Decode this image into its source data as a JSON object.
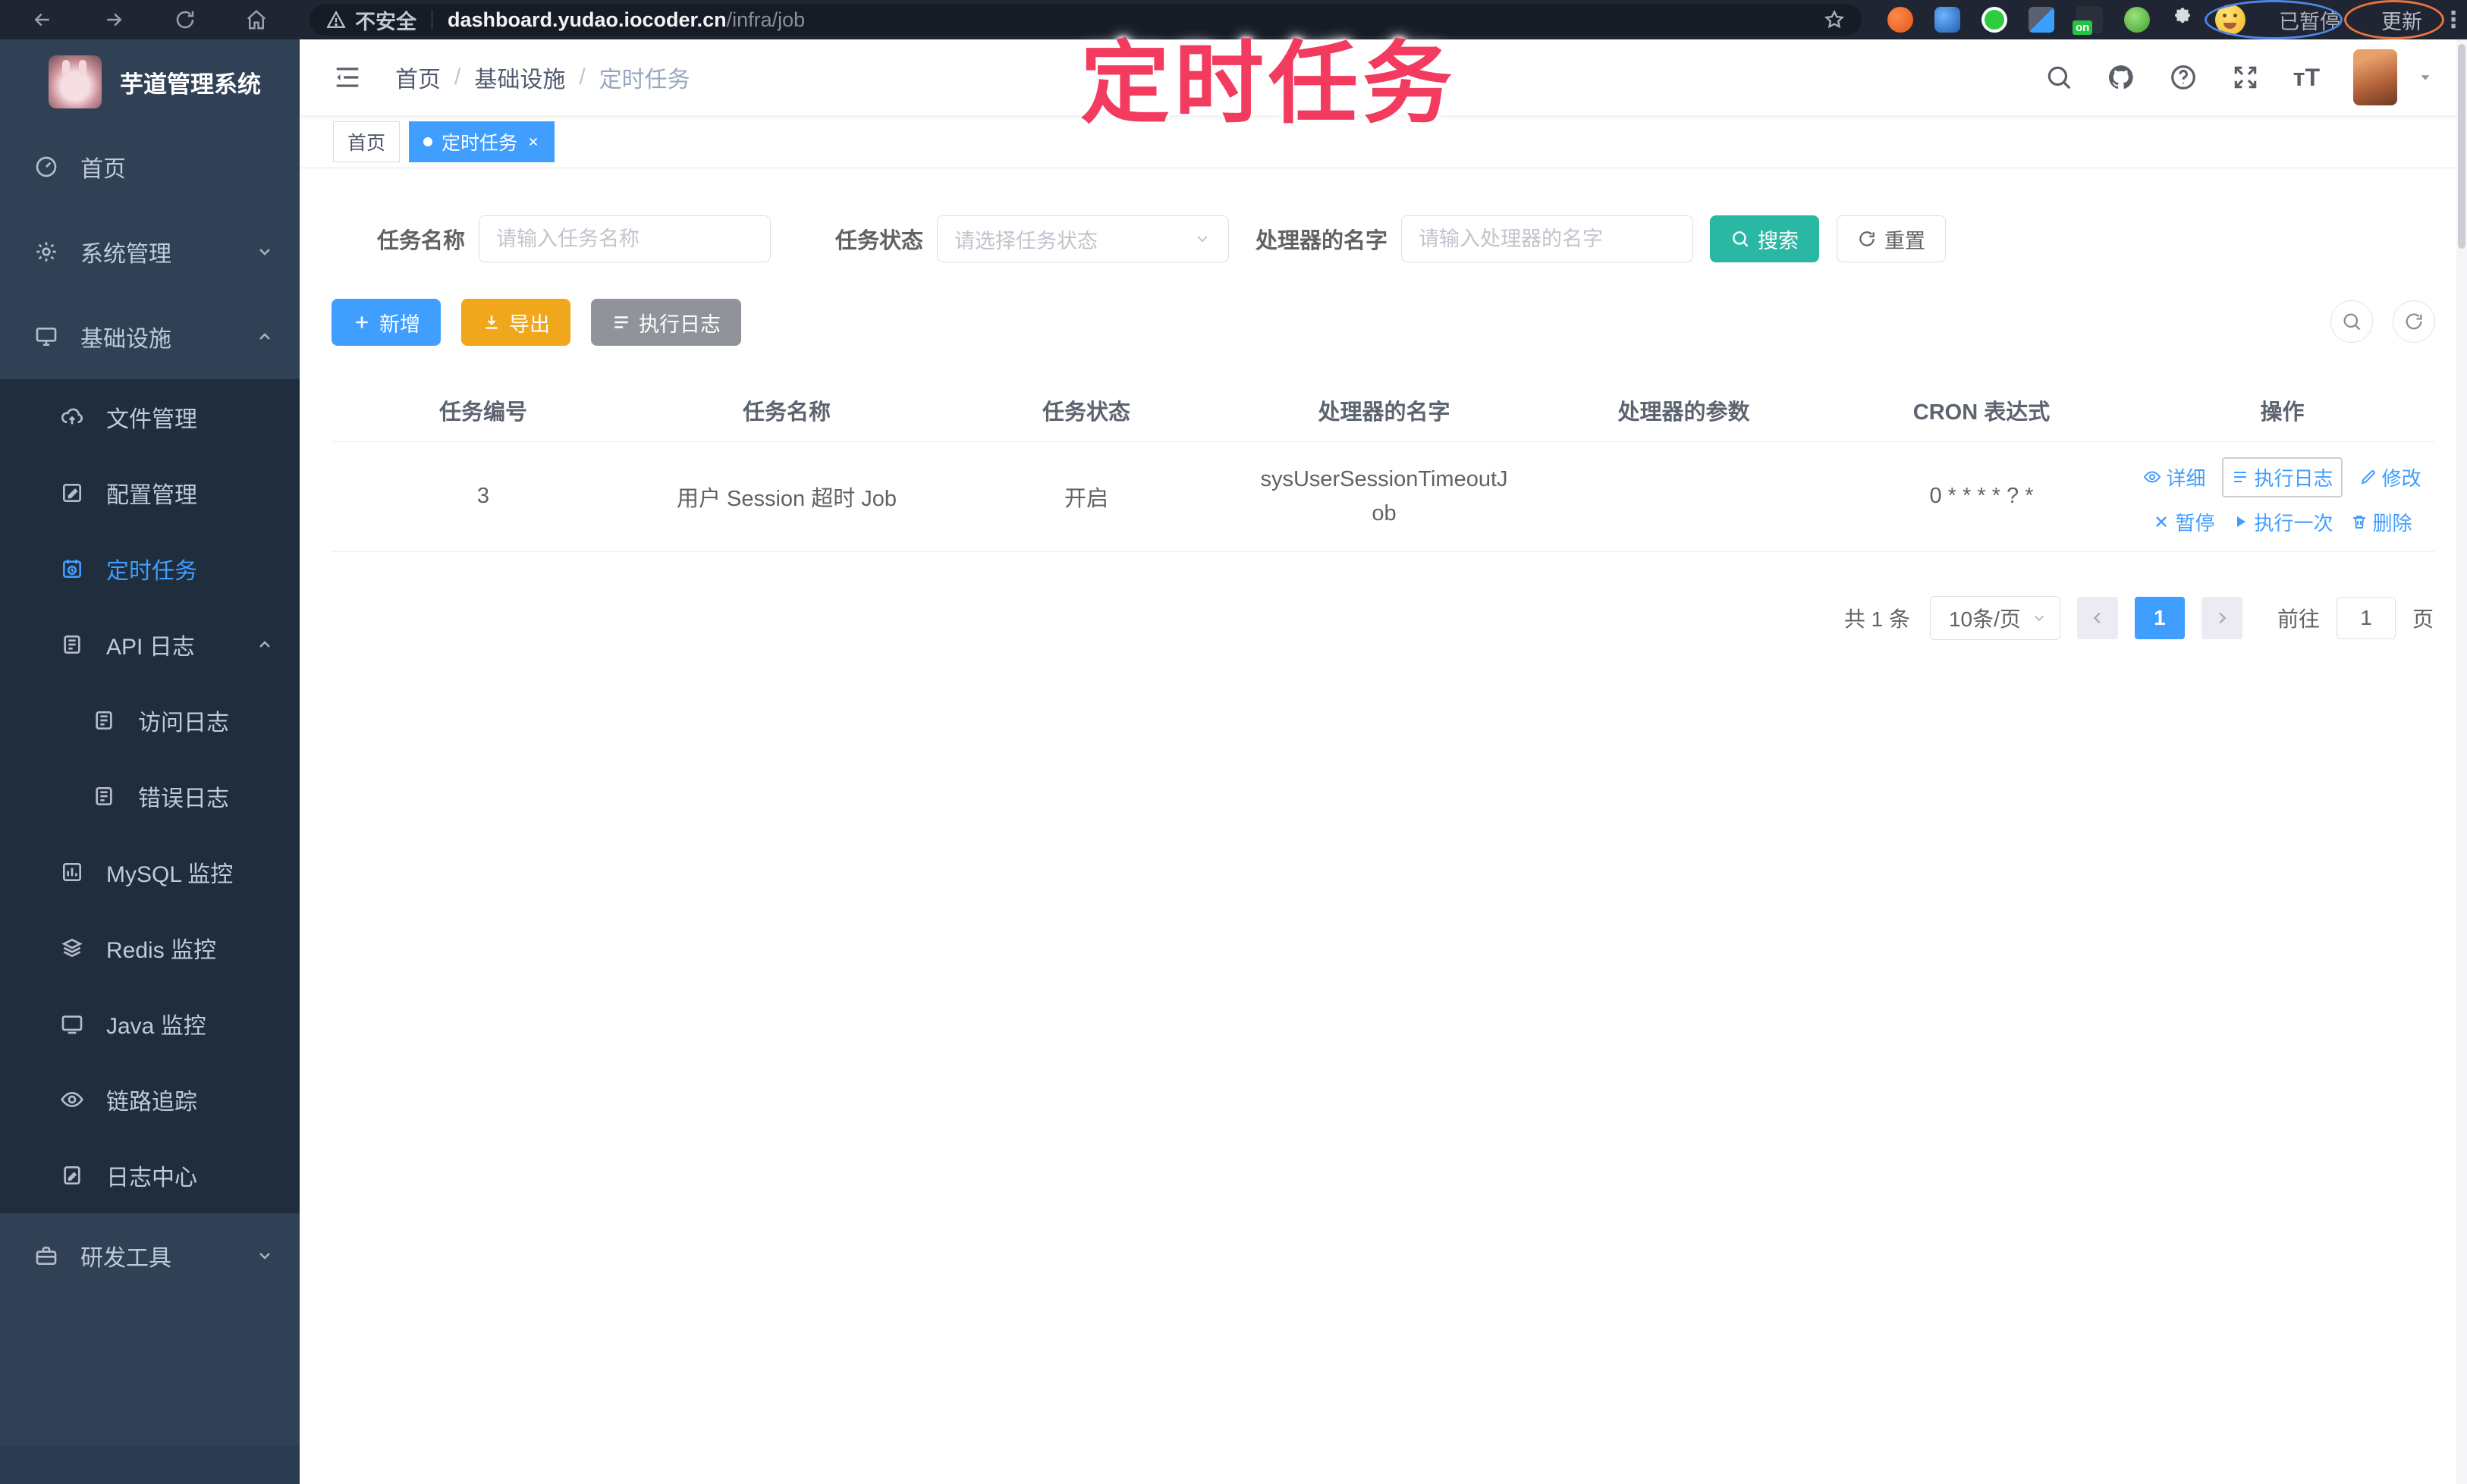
{
  "browser": {
    "security_label": "不安全",
    "url_host": "dashboard.yudao.iocoder.cn",
    "url_path": "/infra/job",
    "extension_badge": "on",
    "paused_label": "已暂停",
    "update_label": "更新"
  },
  "annotation": {
    "title": "定时任务",
    "color": "#f23b5e"
  },
  "sidebar": {
    "app_title": "芋道管理系统",
    "items": [
      {
        "label": "首页",
        "icon": "dashboard-icon"
      },
      {
        "label": "系统管理",
        "icon": "gear-icon",
        "expanded": false
      },
      {
        "label": "基础设施",
        "icon": "monitor-icon",
        "expanded": true,
        "children": [
          {
            "label": "文件管理",
            "icon": "cloud-upload-icon"
          },
          {
            "label": "配置管理",
            "icon": "edit-icon"
          },
          {
            "label": "定时任务",
            "icon": "timer-icon",
            "active": true
          },
          {
            "label": "API 日志",
            "icon": "document-icon",
            "expanded": true,
            "children": [
              {
                "label": "访问日志",
                "icon": "document-icon"
              },
              {
                "label": "错误日志",
                "icon": "document-icon"
              }
            ]
          },
          {
            "label": "MySQL 监控",
            "icon": "chart-icon"
          },
          {
            "label": "Redis 监控",
            "icon": "layers-icon"
          },
          {
            "label": "Java 监控",
            "icon": "display-icon"
          },
          {
            "label": "链路追踪",
            "icon": "eye-icon"
          },
          {
            "label": "日志中心",
            "icon": "document-icon"
          }
        ]
      },
      {
        "label": "研发工具",
        "icon": "briefcase-icon",
        "expanded": false
      }
    ]
  },
  "header": {
    "breadcrumb": [
      "首页",
      "基础设施",
      "定时任务"
    ],
    "separator": "/"
  },
  "tabs": [
    {
      "label": "首页",
      "active": false
    },
    {
      "label": "定时任务",
      "active": true
    }
  ],
  "filters": {
    "name_label": "任务名称",
    "name_placeholder": "请输入任务名称",
    "status_label": "任务状态",
    "status_placeholder": "请选择任务状态",
    "handler_label": "处理器的名字",
    "handler_placeholder": "请输入处理器的名字",
    "search_label": "搜索",
    "reset_label": "重置"
  },
  "toolbar": {
    "add_label": "新增",
    "export_label": "导出",
    "exec_log_label": "执行日志"
  },
  "table": {
    "columns": [
      "任务编号",
      "任务名称",
      "任务状态",
      "处理器的名字",
      "处理器的参数",
      "CRON 表达式",
      "操作"
    ],
    "rows": [
      {
        "id": "3",
        "name": "用户 Session 超时 Job",
        "status": "开启",
        "handler": "sysUserSessionTimeoutJob",
        "param": "",
        "cron": "0 * * * * ? *"
      }
    ],
    "row_actions": [
      "详细",
      "执行日志",
      "修改",
      "暂停",
      "执行一次",
      "删除"
    ]
  },
  "pagination": {
    "total": "共 1 条",
    "page_size": "10条/页",
    "current_page": "1",
    "goto_label": "前往",
    "goto_value": "1",
    "page_unit": "页"
  },
  "colors": {
    "primary": "#409eff",
    "teal": "#2ab8a5",
    "warning": "#f0a71c",
    "gray": "#909399",
    "sidebar_bg": "#304156",
    "submenu_bg": "#1f2d3d",
    "red": "#f23b5e"
  }
}
